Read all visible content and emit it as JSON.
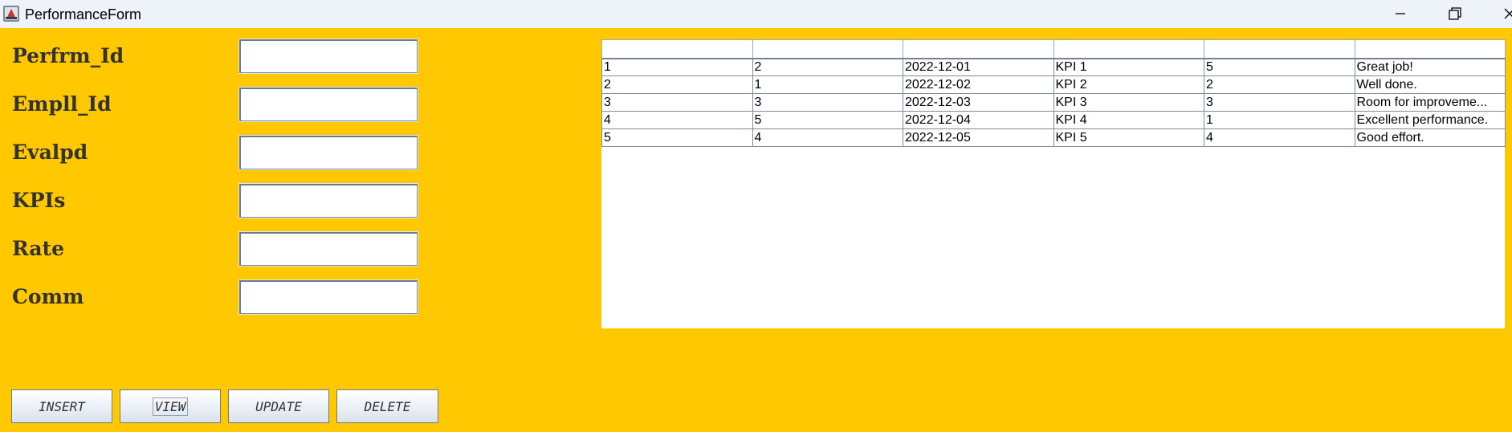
{
  "window": {
    "title": "PerformanceForm"
  },
  "form": {
    "labels": [
      "Perfrm_Id",
      "Empll_Id",
      "Evalpd",
      "KPIs",
      "Rate",
      "Comm"
    ],
    "values": [
      "",
      "",
      "",
      "",
      "",
      ""
    ]
  },
  "buttons": {
    "insert": "INSERT",
    "view": "VIEW",
    "update": "UPDATE",
    "delete": "DELETE"
  },
  "table": {
    "headers": [
      "",
      "",
      "",
      "",
      "",
      ""
    ],
    "rows": [
      [
        "1",
        "2",
        "2022-12-01",
        "KPI 1",
        "5",
        "Great job!"
      ],
      [
        "2",
        "1",
        "2022-12-02",
        "KPI 2",
        "2",
        "Well done."
      ],
      [
        "3",
        "3",
        "2022-12-03",
        "KPI 3",
        "3",
        "Room for improveme..."
      ],
      [
        "4",
        "5",
        "2022-12-04",
        "KPI 4",
        "1",
        "Excellent performance."
      ],
      [
        "5",
        "4",
        "2022-12-05",
        "KPI 5",
        "4",
        "Good effort."
      ]
    ]
  }
}
